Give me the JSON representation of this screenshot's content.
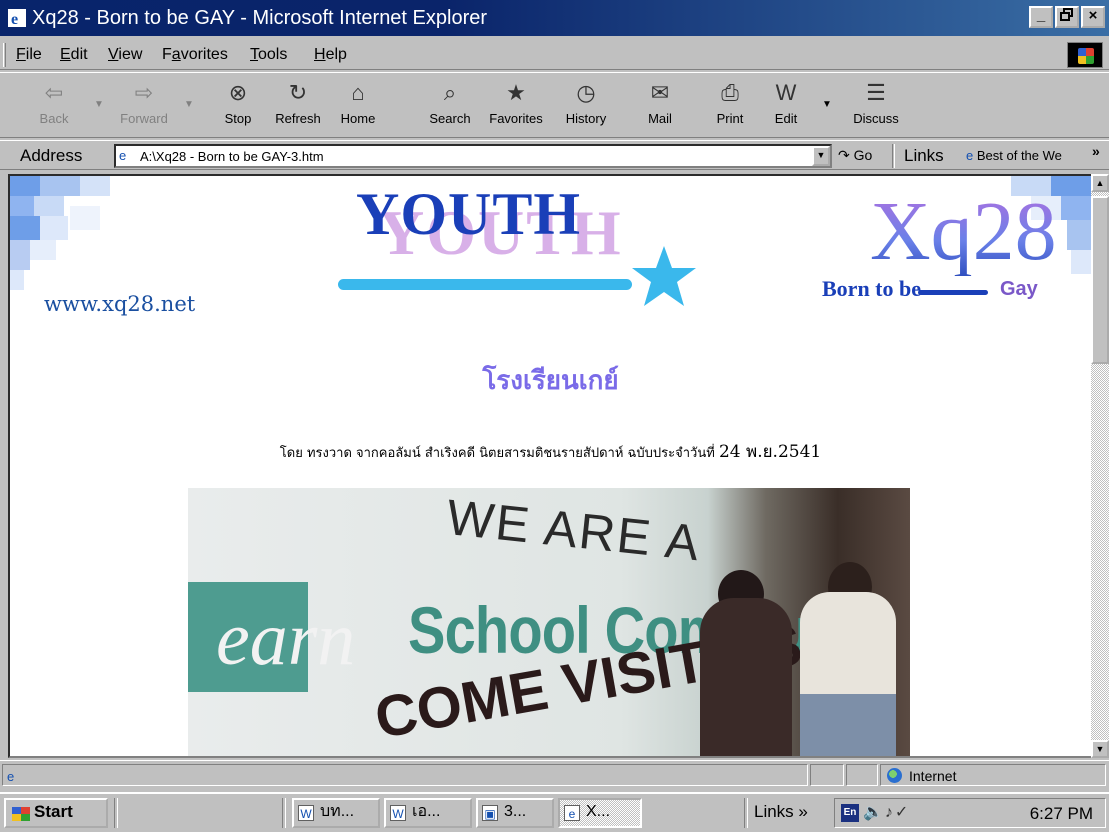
{
  "window": {
    "title": "Xq28 - Born to be GAY - Microsoft Internet Explorer",
    "controls": [
      "_",
      "×"
    ]
  },
  "menu": {
    "items": [
      {
        "pre": "",
        "u": "F",
        "post": "ile"
      },
      {
        "pre": "",
        "u": "E",
        "post": "dit"
      },
      {
        "pre": "",
        "u": "V",
        "post": "iew"
      },
      {
        "pre": "F",
        "u": "a",
        "post": "vorites"
      },
      {
        "pre": "",
        "u": "T",
        "post": "ools"
      },
      {
        "pre": "",
        "u": "H",
        "post": "elp"
      }
    ]
  },
  "toolbar": {
    "buttons": [
      {
        "label": "Back",
        "icon": "back-arrow-icon",
        "glyph": "⇦",
        "disabled": true
      },
      {
        "label": "Forward",
        "icon": "forward-arrow-icon",
        "glyph": "⇨",
        "disabled": true
      },
      {
        "label": "Stop",
        "icon": "stop-icon",
        "glyph": "⊗"
      },
      {
        "label": "Refresh",
        "icon": "refresh-icon",
        "glyph": "↻"
      },
      {
        "label": "Home",
        "icon": "home-icon",
        "glyph": "⌂"
      },
      {
        "label": "Search",
        "icon": "search-icon",
        "glyph": "⌕"
      },
      {
        "label": "Favorites",
        "icon": "favorites-icon",
        "glyph": "★"
      },
      {
        "label": "History",
        "icon": "history-icon",
        "glyph": "◷"
      },
      {
        "label": "Mail",
        "icon": "mail-icon",
        "glyph": "✉"
      },
      {
        "label": "Print",
        "icon": "print-icon",
        "glyph": "⎙"
      },
      {
        "label": "Edit",
        "icon": "edit-icon",
        "glyph": "W"
      },
      {
        "label": "Discuss",
        "icon": "discuss-icon",
        "glyph": "☰"
      }
    ]
  },
  "address": {
    "label": "Address",
    "value": "A:\\Xq28 - Born to be GAY-3.htm",
    "go_label": "Go",
    "links_label": "Links",
    "links_item": "Best of the We",
    "more": "»"
  },
  "page": {
    "site_url": "www.xq28.net",
    "banner_word": "YOUTH",
    "logo_main": "Xq28",
    "logo_tag": "Born to be",
    "logo_gay": "Gay",
    "heading": "โรงเรียนเกย์",
    "byline_text": "โดย ทรงวาด จากคอลัมน์ สำเริงคดี นิตยสารมติชนรายสัปดาห์ ฉบับประจำวันที่",
    "byline_date": "24 พ.ย.2541",
    "photo": {
      "line1": "WE ARE A",
      "line2_left": "earn",
      "line2_right": "School Communi",
      "line3": "COME VISIT US!"
    }
  },
  "status": {
    "zone": "Internet"
  },
  "taskbar": {
    "start": "Start",
    "tasks": [
      {
        "label": "บท...",
        "icon": "word-doc-icon",
        "glyph": "W"
      },
      {
        "label": "เอ...",
        "icon": "word-doc-icon",
        "glyph": "W"
      },
      {
        "label": "3...",
        "icon": "window-icon",
        "glyph": "▣"
      },
      {
        "label": "X...",
        "icon": "ie-icon",
        "glyph": "e",
        "active": true
      }
    ],
    "links": "Links »",
    "lang": "En",
    "clock": "6:27 PM"
  }
}
